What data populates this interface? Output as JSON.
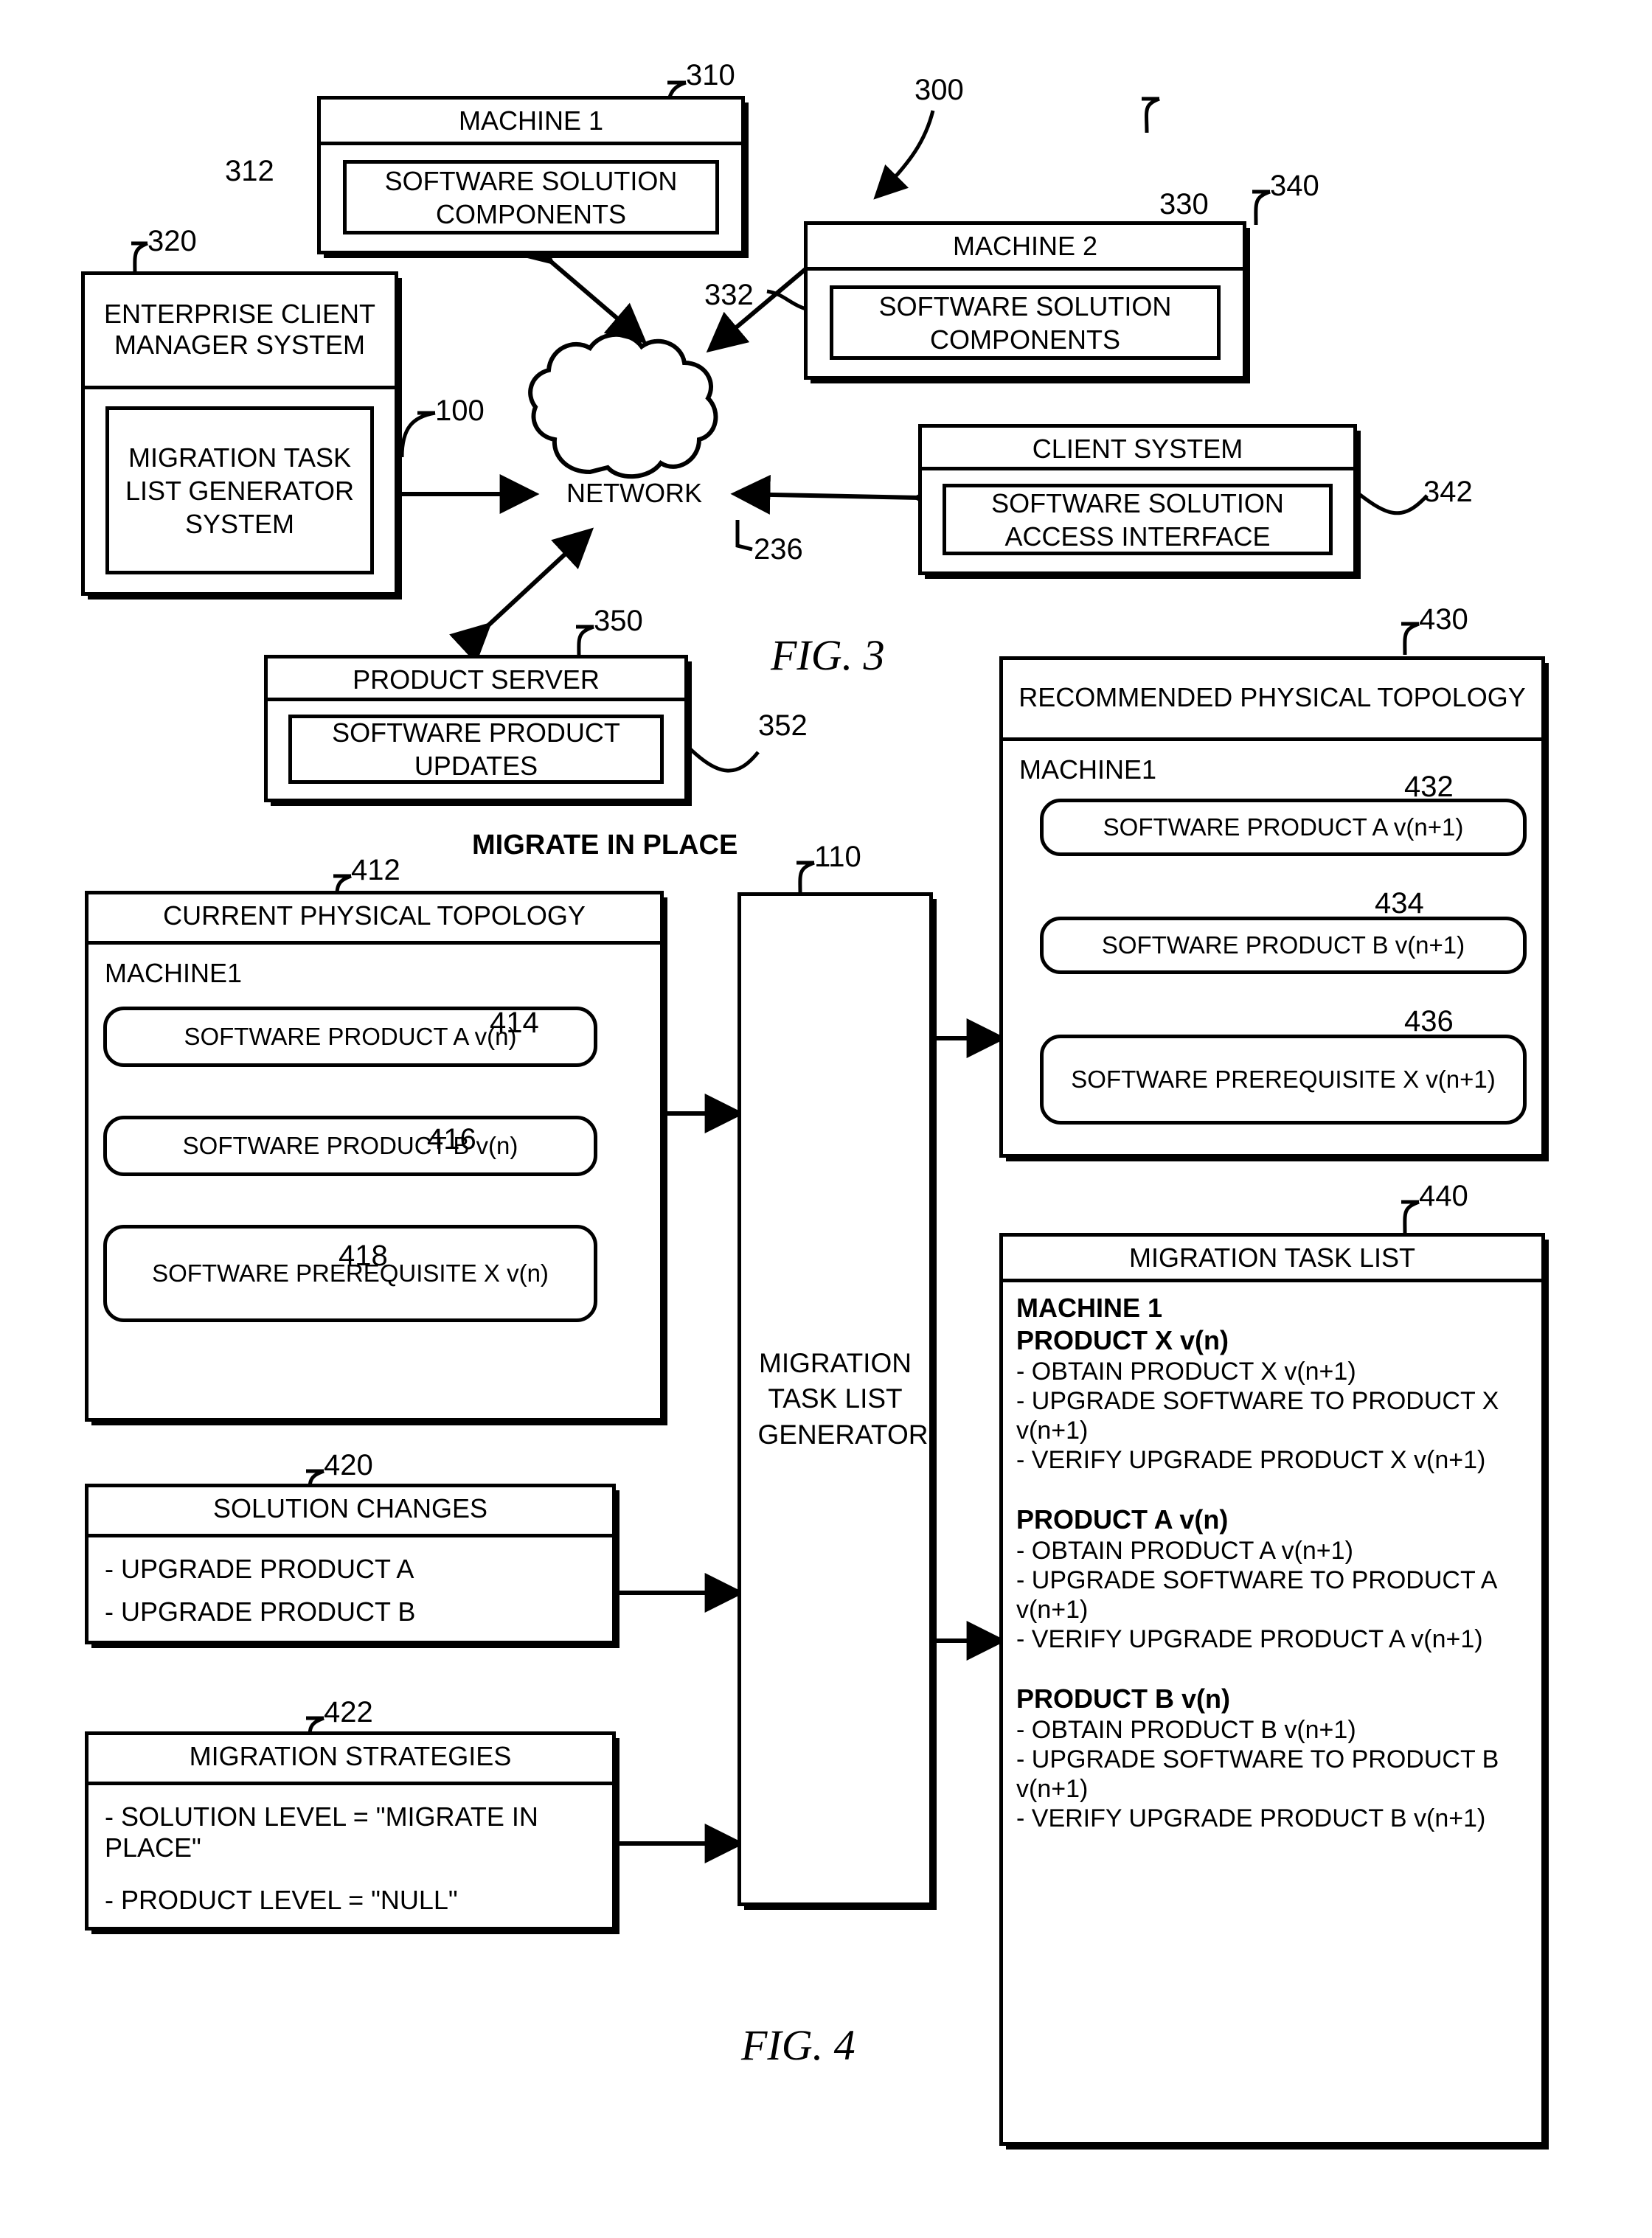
{
  "figures": {
    "fig3_label": "FIG. 3",
    "fig4_label": "FIG. 4"
  },
  "fig3": {
    "overall_ref": "300",
    "machine1": {
      "ref": "310",
      "title": "MACHINE 1",
      "component_ref": "312",
      "component_label": "SOFTWARE SOLUTION COMPONENTS"
    },
    "machine2": {
      "ref": "330",
      "title": "MACHINE 2",
      "component_ref": "332",
      "component_label": "SOFTWARE SOLUTION COMPONENTS"
    },
    "enterprise": {
      "ref": "320",
      "title": "ENTERPRISE CLIENT MANAGER SYSTEM",
      "inner_ref": "100",
      "inner_label": "MIGRATION TASK LIST GENERATOR SYSTEM"
    },
    "client_system": {
      "ref": "340",
      "title": "CLIENT SYSTEM",
      "interface_ref": "342",
      "interface_label": "SOFTWARE SOLUTION ACCESS INTERFACE"
    },
    "product_server": {
      "ref": "350",
      "title": "PRODUCT SERVER",
      "updates_ref": "352",
      "updates_label": "SOFTWARE PRODUCT UPDATES"
    },
    "network": {
      "ref": "236",
      "label": "NETWORK"
    }
  },
  "fig4": {
    "banner": "MIGRATE IN PLACE",
    "current_topology": {
      "ref": "412",
      "title": "CURRENT PHYSICAL TOPOLOGY",
      "machine_label": "MACHINE1",
      "items": [
        {
          "ref": "414",
          "label": "SOFTWARE PRODUCT A v(n)"
        },
        {
          "ref": "416",
          "label": "SOFTWARE PRODUCT B v(n)"
        },
        {
          "ref": "418",
          "label": "SOFTWARE PREREQUISITE X v(n)"
        }
      ]
    },
    "solution_changes": {
      "ref": "420",
      "title": "SOLUTION CHANGES",
      "items": [
        "- UPGRADE PRODUCT A",
        "- UPGRADE PRODUCT B"
      ]
    },
    "migration_strategies": {
      "ref": "422",
      "title": "MIGRATION STRATEGIES",
      "items": [
        "- SOLUTION LEVEL = \"MIGRATE IN PLACE\"",
        "- PRODUCT LEVEL = \"NULL\""
      ]
    },
    "generator": {
      "ref": "110",
      "label": "MIGRATION TASK LIST GENERATOR"
    },
    "recommended_topology": {
      "ref": "430",
      "title": "RECOMMENDED PHYSICAL TOPOLOGY",
      "machine_label": "MACHINE1",
      "items": [
        {
          "ref": "432",
          "label": "SOFTWARE PRODUCT A v(n+1)"
        },
        {
          "ref": "434",
          "label": "SOFTWARE PRODUCT B v(n+1)"
        },
        {
          "ref": "436",
          "label": "SOFTWARE PREREQUISITE X v(n+1)"
        }
      ]
    },
    "task_list": {
      "ref": "440",
      "title": "MIGRATION TASK LIST",
      "machine_heading": "MACHINE 1",
      "groups": [
        {
          "heading": "PRODUCT X v(n)",
          "tasks": [
            "- OBTAIN PRODUCT X v(n+1)",
            "- UPGRADE SOFTWARE TO PRODUCT X v(n+1)",
            "- VERIFY UPGRADE PRODUCT  X v(n+1)"
          ]
        },
        {
          "heading": "PRODUCT A v(n)",
          "tasks": [
            "- OBTAIN PRODUCT A v(n+1)",
            "- UPGRADE SOFTWARE TO PRODUCT A v(n+1)",
            "- VERIFY UPGRADE PRODUCT A v(n+1)"
          ]
        },
        {
          "heading": "PRODUCT B v(n)",
          "tasks": [
            "- OBTAIN PRODUCT B v(n+1)",
            "- UPGRADE SOFTWARE TO PRODUCT B v(n+1)",
            "- VERIFY UPGRADE PRODUCT  B v(n+1)"
          ]
        }
      ]
    }
  }
}
